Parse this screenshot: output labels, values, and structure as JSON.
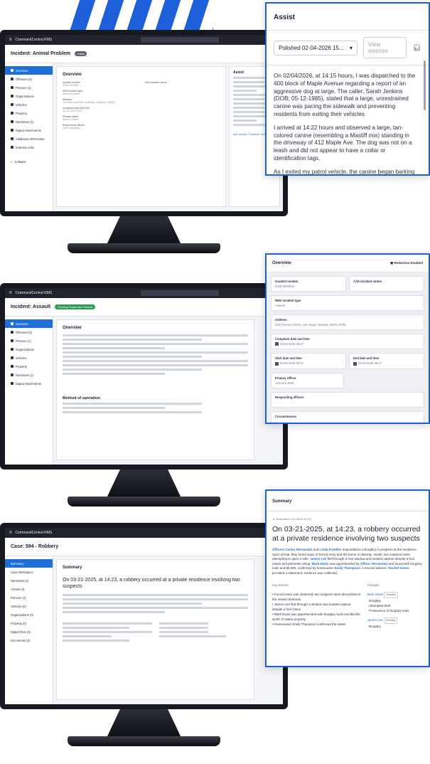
{
  "colors": {
    "brand_blue": "#1d5fd8",
    "active_blue": "#1e6fd9",
    "green_pill": "#2d9b4f"
  },
  "screen1": {
    "app_name": "CommandCentral RMS",
    "incident_title": "Incident: Animal Problem",
    "status_pill": "Initial",
    "overview_heading": "Overview",
    "assist_heading": "Assist",
    "nav": [
      "Overview",
      "Offenses (0)",
      "Persons (1)",
      "Organizations",
      "Vehicles",
      "Property",
      "Narratives (1)",
      "Digital Attachments",
      "Additional Information",
      "External Links",
      "Collapse"
    ],
    "fields": [
      {
        "label": "Incident number",
        "value": "2026-0000016"
      },
      {
        "label": "CAD incident nature",
        "value": "-"
      },
      {
        "label": "RMS incident type",
        "value": "Animal Problem"
      },
      {
        "label": "Address",
        "value": "123 Main Street Dr, Dadeville, Alabama, 36853"
      },
      {
        "label": "Complaint date and time",
        "value": "02-04-2026 15:07"
      },
      {
        "label": "Primary officer",
        "value": "Andrew Cabra"
      },
      {
        "label": "Responding officers",
        "value": "Josh Krakoskey"
      }
    ],
    "buttons": [
      "Add sources",
      "Proofread",
      "Polish"
    ]
  },
  "assist_popout": {
    "title": "Assist",
    "version_select": "Polished 02-04-2026 15...",
    "view_sources": "View sources",
    "paragraphs": [
      "On 02/04/2026, at 14:15 hours, I was dispatched to the 400 block of Maple Avenue regarding a report of an aggressive dog at large. The caller, Sarah Jenkins (DOB: 05-12-1985), stated that a large, unrestrained canine was pacing the sidewalk and preventing residents from exiting their vehicles.",
      "I arrived at 14:22 hours and observed a large, tan-colored canine (resembling a Mastiff mix) standing in the driveway of 412 Maple Ave. The dog was not on a leash and did not appear to have a collar or identification tags.",
      "As I exited my patrol vehicle, the canine began barking loudly, baring its teeth, and took a rigid stance. I maintained a safe distance and utilized my"
    ]
  },
  "screen2": {
    "incident_title": "Incident: Assault",
    "status_pill": "Pending Supervisor Review",
    "overview_heading": "Overview",
    "section_heading": "Method of operation"
  },
  "overview_popout": {
    "title": "Overview",
    "redaction": "Redaction Enabled",
    "fields": [
      {
        "label": "Incident number",
        "value": "2026-0000024"
      },
      {
        "label": "CAD incident nature",
        "value": "-"
      },
      {
        "label": "RMS incident type",
        "value": "Assault"
      },
      {
        "label": "Address",
        "value": "423 Fremont Street, Las Vegas, Nevada, 89101-5009"
      },
      {
        "label": "Complaint date and time",
        "value": "03-03-2026 09:27"
      },
      {
        "label": "Start date and time",
        "value": "03-04-2026 09:27"
      },
      {
        "label": "End date and time",
        "value": "03-04-2026 09:27"
      },
      {
        "label": "Primary officer",
        "value": "Veronica Neal"
      },
      {
        "label": "Responding officers",
        "value": "-"
      },
      {
        "label": "Circumstances",
        "value": "-"
      }
    ]
  },
  "screen3": {
    "case_title": "Case: 594 - Robbery",
    "summary_heading": "Summary",
    "nav": [
      "Summary",
      "Case Workspace",
      "Narratives (4)",
      "Arrests (0)",
      "Persons (4)",
      "Vehicles (0)",
      "Organizations (0)",
      "Property (0)",
      "Digital Files (0)",
      "Documents (0)"
    ]
  },
  "summary_popout": {
    "title": "Summary",
    "generated": "Generated 4-20-2025 10:15",
    "headline": "On 03-21-2025, at 14:23, a robbery occurred at a private residence involving two suspects",
    "key_events_label": "Key Events",
    "charges_label": "Charges",
    "events": [
      "Forced entry was observed; two suspects were discovered in the master bedroom",
      "James Lee fled through a window and evaded capture despite a foot chase",
      "Mark Davis was apprehended with burglary tools and $5,000 worth of stolen property",
      "Homeowner Emily Thompson confirmed the stolen"
    ],
    "charges": [
      {
        "name": "Mark Davis",
        "badge": "Arrested",
        "items": [
          "Burglary",
          "Attempted theft",
          "Possession of burglary tools"
        ]
      },
      {
        "name": "James Lee",
        "badge": "Pending",
        "items": [
          "Burglary"
        ]
      }
    ]
  }
}
